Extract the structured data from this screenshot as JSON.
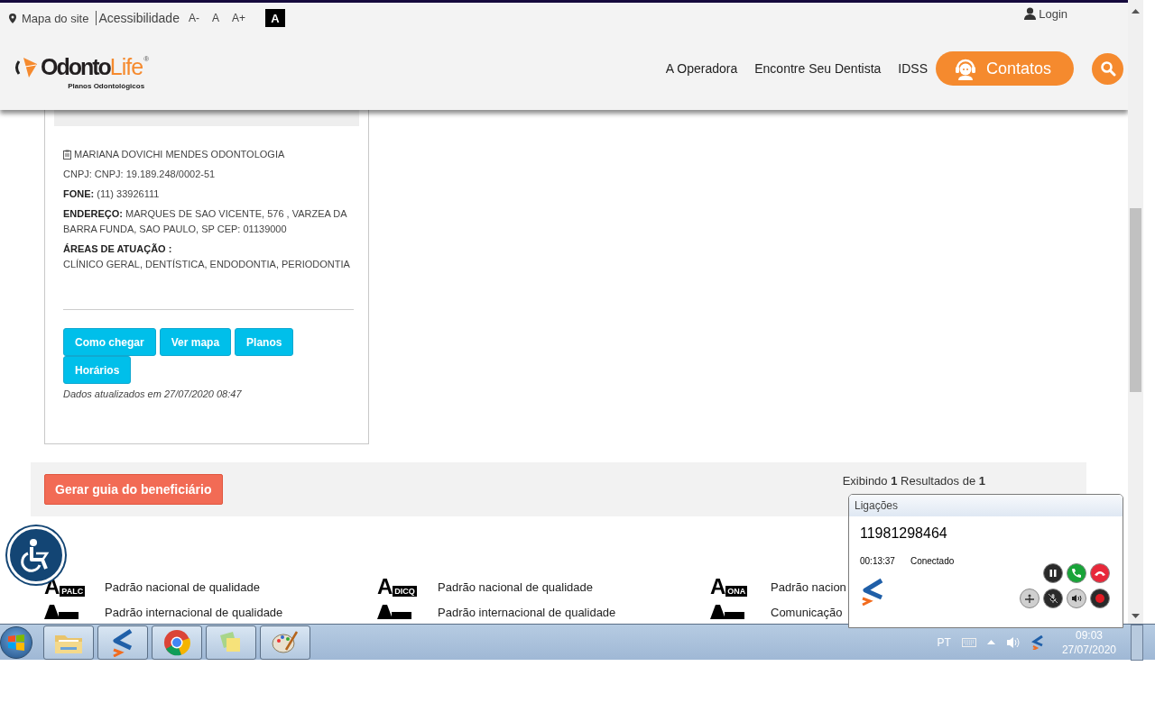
{
  "header": {
    "site_map": "Mapa do site",
    "accessibility": "Acessibilidade",
    "font_sizes": [
      "A-",
      "A",
      "A+"
    ],
    "contrast": "A",
    "login": "Login",
    "logo": {
      "name": "Odonto",
      "accent": "Life",
      "mark": "®",
      "tagline": "Planos Odontológicos"
    },
    "nav": [
      "A Operadora",
      "Encontre Seu Dentista",
      "IDSS"
    ],
    "contact_button": "Contatos"
  },
  "card": {
    "name": "MARIANA DOVICHI MENDES ODONTOLOGIA",
    "details": [
      "CNPJ: CNPJ: 19.189.248/0002-51",
      "**FONE:** (11) 33926111",
      "**ENDEREÇO:** MARQUES DE SAO VICENTE, 576 , VARZEA DA BARRA FUNDA, SAO PAULO, SP CEP: 01139000"
    ],
    "areas_label": "ÁREAS DE ATUAÇÃO :",
    "areas": "CLÍNICO GERAL, DENTÍSTICA, ENDODONTIA, PERIODONTIA",
    "buttons": [
      "Como chegar",
      "Ver mapa",
      "Planos",
      "Horários"
    ],
    "updated": "Dados atualizados em 27/07/2020 08:47"
  },
  "results": {
    "button": "Gerar guia do beneficiário",
    "summary": "Exibindo **1** Resultados de **1**"
  },
  "quality": [
    {
      "letter": "A",
      "code": "PALC",
      "text": "Padrão nacional de qualidade"
    },
    {
      "letter": "A",
      "code": "DICQ",
      "text": "Padrão nacional de qualidade"
    },
    {
      "letter": "A",
      "code": "ONA",
      "text": "Padrão nacion"
    },
    {
      "text": "Padrão internacional de qualidade"
    },
    {
      "text": "Padrão internacional de qualidade"
    },
    {
      "text": "Comunicação"
    }
  ],
  "call_popup": {
    "title": "Ligações",
    "number": "11981298464",
    "duration": "00:13:37",
    "status": "Conectado"
  },
  "taskbar": {
    "apps": [
      {
        "kind": "folder"
      },
      {
        "kind": "softphone"
      },
      {
        "kind": "browser"
      },
      {
        "kind": "notes"
      },
      {
        "kind": "paint"
      }
    ],
    "language": "PT",
    "time": "09:03",
    "date": "27/07/2020"
  }
}
